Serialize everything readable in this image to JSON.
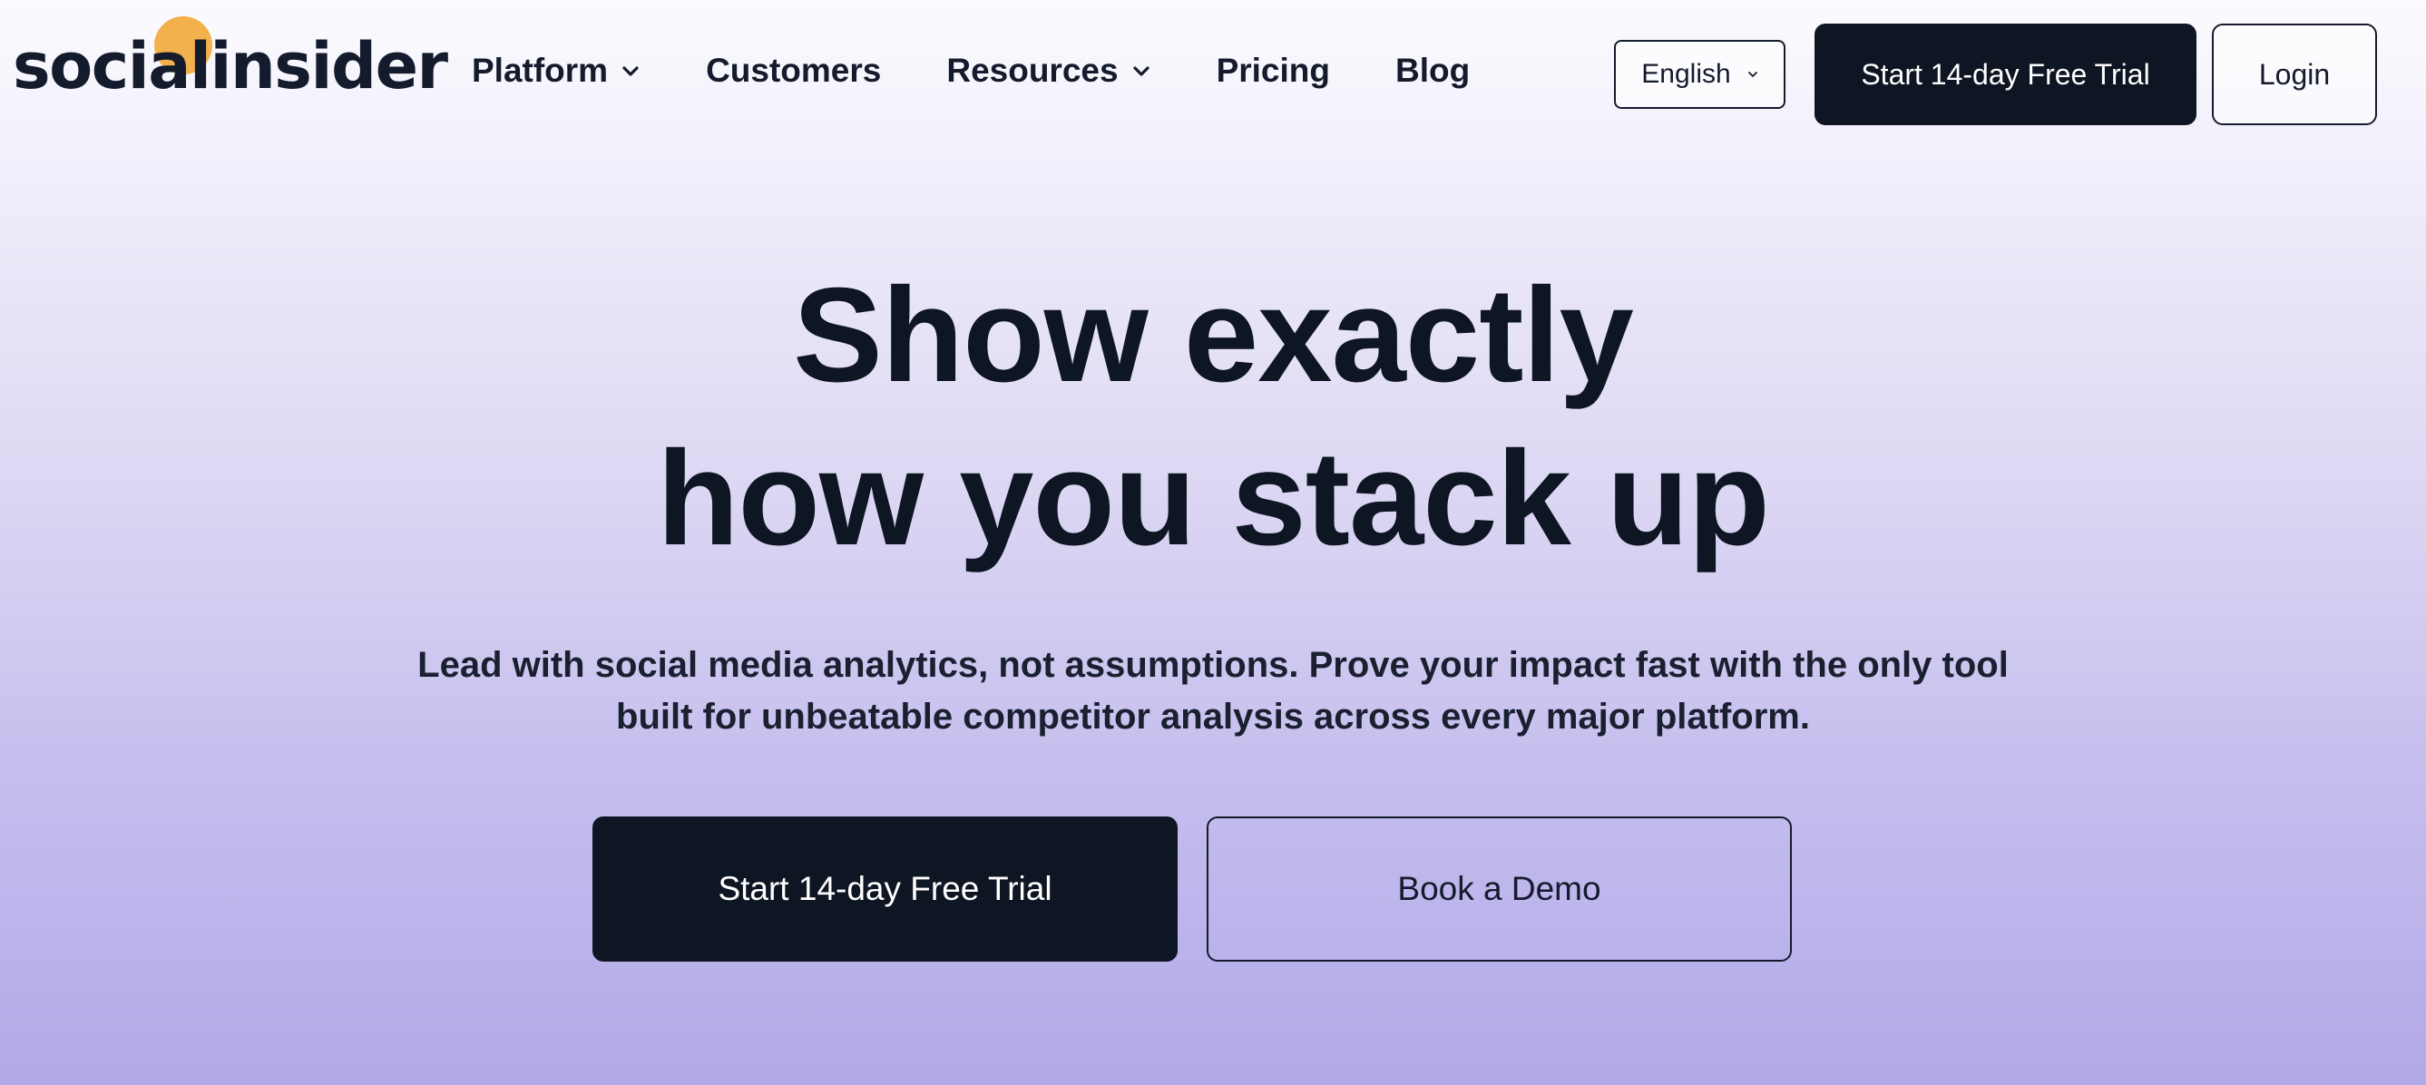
{
  "brand": {
    "name": "socialinsider",
    "logo_accent": "#f2b14c"
  },
  "nav": {
    "items": [
      {
        "label": "Platform",
        "has_dropdown": true
      },
      {
        "label": "Customers",
        "has_dropdown": false
      },
      {
        "label": "Resources",
        "has_dropdown": true
      },
      {
        "label": "Pricing",
        "has_dropdown": false
      },
      {
        "label": "Blog",
        "has_dropdown": false
      }
    ]
  },
  "header": {
    "language": "English",
    "trial_label": "Start 14-day Free Trial",
    "login_label": "Login"
  },
  "hero": {
    "title_line1": "Show exactly",
    "title_line2": "how you stack up",
    "subtitle": "Lead with social media analytics, not assumptions. Prove your impact fast with the only tool built for unbeatable competitor analysis across every major platform.",
    "primary_cta": "Start 14-day Free Trial",
    "secondary_cta": "Book a Demo"
  },
  "colors": {
    "dark": "#0f1623",
    "gradient_top": "#fbfbfe",
    "gradient_bottom": "#b2a9e8"
  }
}
